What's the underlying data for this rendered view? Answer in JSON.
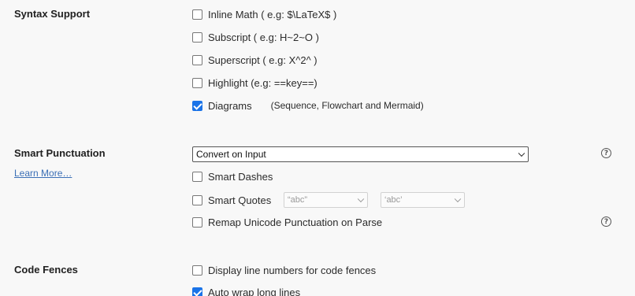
{
  "syntax_support": {
    "title": "Syntax Support",
    "options": [
      {
        "label": "Inline Math ( e.g: $\\LaTeX$ )",
        "checked": false
      },
      {
        "label": "Subscript ( e.g: H~2~O )",
        "checked": false
      },
      {
        "label": "Superscript ( e.g: X^2^ )",
        "checked": false
      },
      {
        "label": "Highlight (e.g: ==key==)",
        "checked": false
      },
      {
        "label": "Diagrams",
        "checked": true,
        "note": "(Sequence, Flowchart and Mermaid)"
      }
    ]
  },
  "smart_punctuation": {
    "title": "Smart Punctuation",
    "learn_more": "Learn More…",
    "mode_select": {
      "value": "Convert on Input"
    },
    "help_icon": "question-circle-icon",
    "smart_dashes": {
      "label": "Smart Dashes",
      "checked": false
    },
    "smart_quotes": {
      "label": "Smart Quotes",
      "checked": false,
      "double_select": "“abc”",
      "single_select": "‘abc’"
    },
    "remap_unicode": {
      "label": "Remap Unicode Punctuation on Parse",
      "checked": false
    }
  },
  "code_fences": {
    "title": "Code Fences",
    "options": [
      {
        "label": "Display line numbers for code fences",
        "checked": false
      },
      {
        "label": "Auto wrap long lines",
        "checked": true
      }
    ]
  },
  "colors": {
    "checkbox_accent": "#1a73e8",
    "link": "#3b6fb6"
  }
}
